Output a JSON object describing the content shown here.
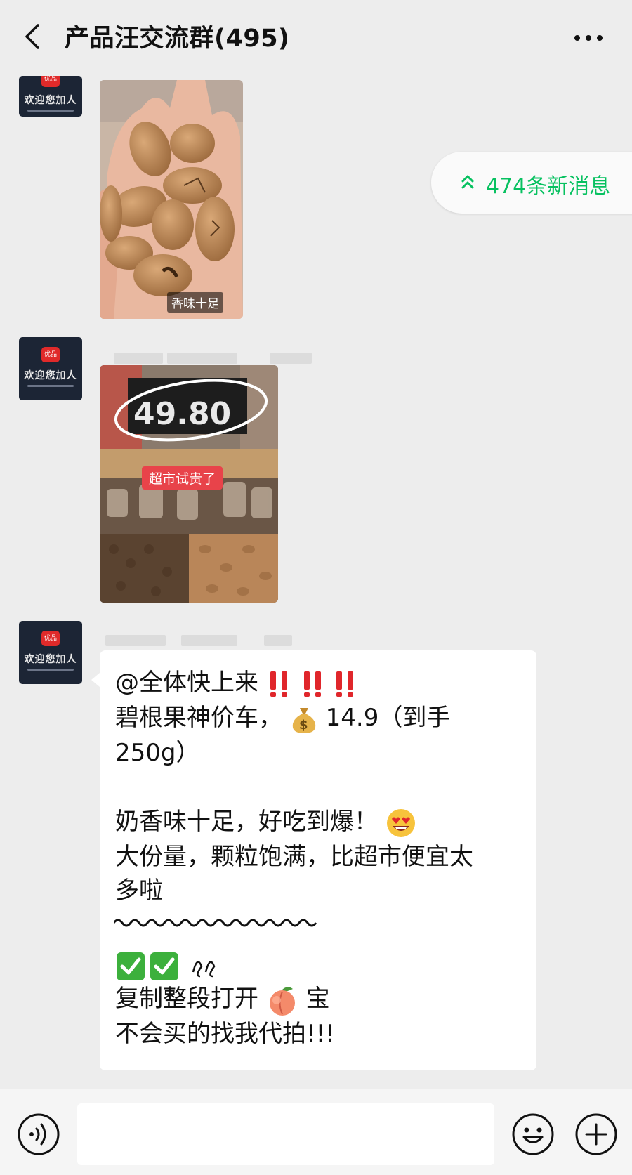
{
  "header": {
    "title": "产品汪交流群(495)"
  },
  "messages": [
    {
      "type": "image",
      "photo_caption": "香味十足"
    },
    {
      "type": "image",
      "photo_caption": "超市试贵了",
      "price_sign": "49.80"
    },
    {
      "type": "text",
      "lines": [
        "@全体快上来",
        "碧根果神价车，",
        "14.9（到手",
        "250g）",
        "奶香味十足，好吃到爆！",
        "大份量，颗粒饱满，比超市便宜太",
        "多啦",
        "复制整段打开",
        "宝",
        "不会买的找我代拍!!!"
      ]
    }
  ],
  "avatar": {
    "label": "欢迎您加人",
    "badge": "优品"
  },
  "new_messages": {
    "label": "474条新消息"
  },
  "input_bar": {
    "placeholder": ""
  },
  "colors": {
    "background": "#ededed",
    "accent_green": "#07c160",
    "bubble": "#ffffff",
    "exclamation_red": "#e0262b"
  },
  "icons": [
    "back-arrow-icon",
    "more-icon",
    "voice-icon",
    "emoji-icon",
    "plus-icon",
    "double-chevron-up-icon",
    "money-bag-icon",
    "heart-eyes-icon",
    "check-mark-icon",
    "peach-icon",
    "exclamation-icon"
  ]
}
